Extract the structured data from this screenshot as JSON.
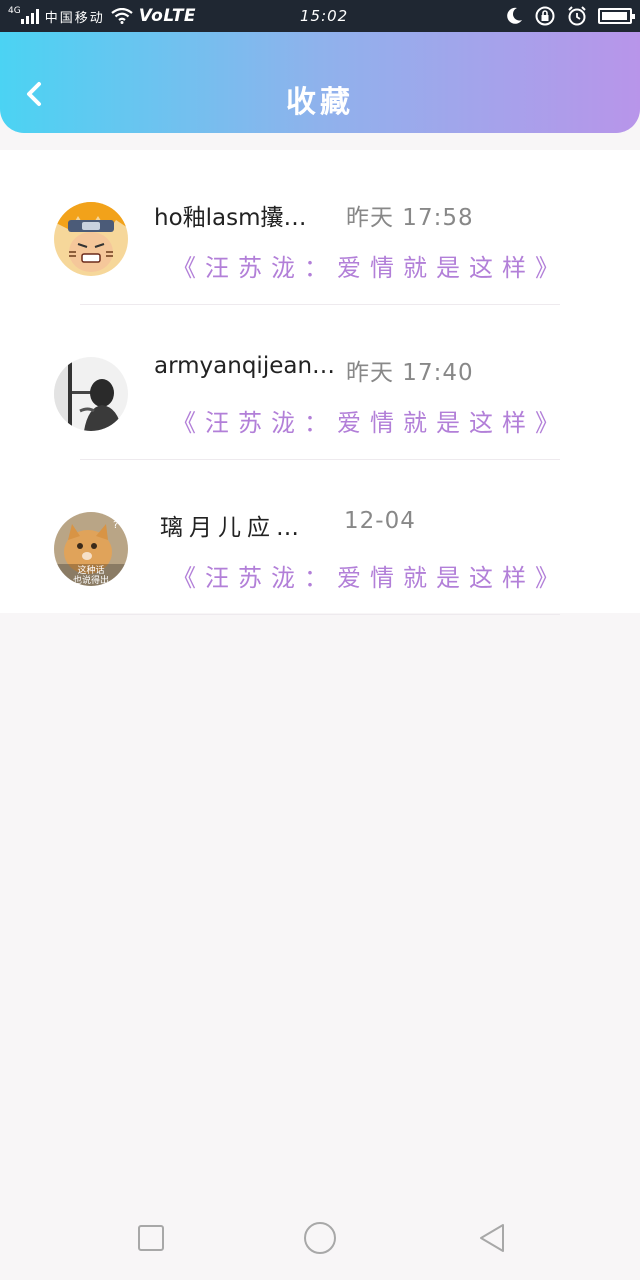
{
  "status_bar": {
    "network_type": "4G",
    "carrier": "中国移动",
    "volte": "VoLTE",
    "time": "15:02",
    "battery_level": 0.95
  },
  "header": {
    "title": "收藏",
    "back_icon": "chevron-left-icon",
    "gradient_start": "#4bd3f3",
    "gradient_end": "#b895ea"
  },
  "favorites": [
    {
      "name": "ho釉lasm攮…",
      "time": "昨天 17:58",
      "song": "《汪苏泷：爱情就是这样》"
    },
    {
      "name": "armyanqijean…",
      "time": "昨天 17:40",
      "song": "《汪苏泷：爱情就是这样》"
    },
    {
      "name": "璃月儿应…",
      "time": "12-04",
      "song": "《汪苏泷：爱情就是这样》"
    }
  ],
  "avatar_3_caption": {
    "line1": "这种话",
    "line2": "也说得出"
  },
  "accent_color": "#b27fd8",
  "nav_bar": {
    "recent_icon": "square-icon",
    "home_icon": "circle-icon",
    "back_icon": "triangle-back-icon"
  }
}
